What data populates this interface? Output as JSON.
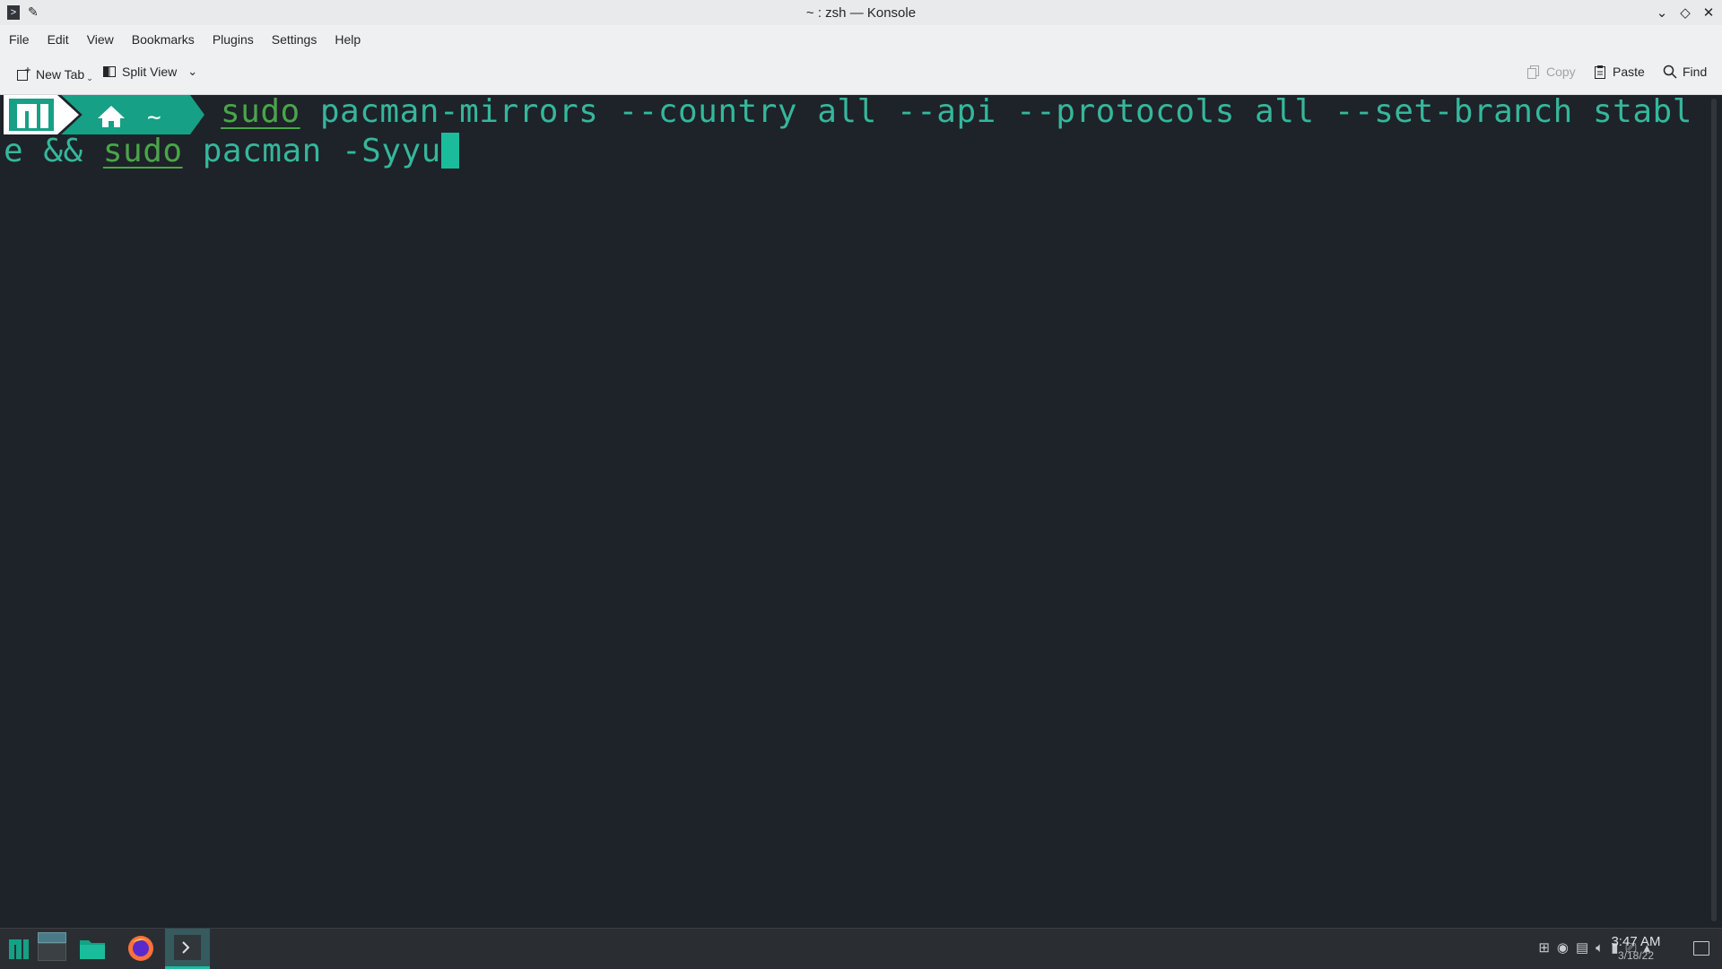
{
  "window": {
    "title": "~ : zsh — Konsole"
  },
  "menubar": {
    "items": [
      "File",
      "Edit",
      "View",
      "Bookmarks",
      "Plugins",
      "Settings",
      "Help"
    ]
  },
  "toolbar": {
    "new_tab": "New Tab",
    "split_view": "Split View",
    "copy": "Copy",
    "paste": "Paste",
    "find": "Find"
  },
  "terminal": {
    "prompt_path": "~",
    "line1": {
      "sudo": "sudo",
      "rest": " pacman-mirrors --country all --api --protocols all --set-branch stabl"
    },
    "line2": {
      "pre": "e && ",
      "sudo": "sudo",
      "rest": " pacman -Syyu"
    }
  },
  "taskbar": {
    "time": "3:47 AM",
    "date": "3/18/22"
  },
  "colors": {
    "accent": "#16a085",
    "prompt_bg": "#16a085",
    "terminal_bg": "#1e2229",
    "command_fg": "#35b79b",
    "sudo_fg": "#4aa54a"
  }
}
